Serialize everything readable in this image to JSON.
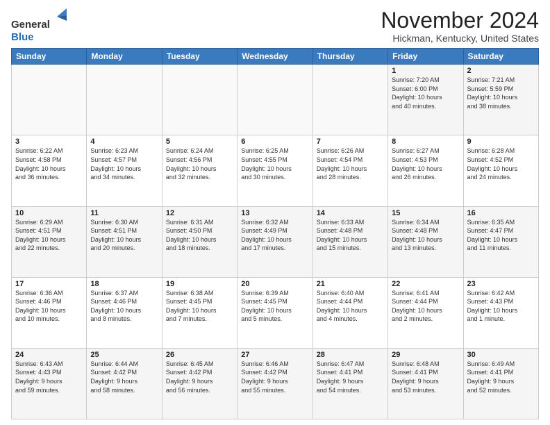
{
  "header": {
    "logo": {
      "line1": "General",
      "line2": "Blue"
    },
    "title": "November 2024",
    "location": "Hickman, Kentucky, United States"
  },
  "weekdays": [
    "Sunday",
    "Monday",
    "Tuesday",
    "Wednesday",
    "Thursday",
    "Friday",
    "Saturday"
  ],
  "weeks": [
    [
      {
        "day": "",
        "info": ""
      },
      {
        "day": "",
        "info": ""
      },
      {
        "day": "",
        "info": ""
      },
      {
        "day": "",
        "info": ""
      },
      {
        "day": "",
        "info": ""
      },
      {
        "day": "1",
        "info": "Sunrise: 7:20 AM\nSunset: 6:00 PM\nDaylight: 10 hours\nand 40 minutes."
      },
      {
        "day": "2",
        "info": "Sunrise: 7:21 AM\nSunset: 5:59 PM\nDaylight: 10 hours\nand 38 minutes."
      }
    ],
    [
      {
        "day": "3",
        "info": "Sunrise: 6:22 AM\nSunset: 4:58 PM\nDaylight: 10 hours\nand 36 minutes."
      },
      {
        "day": "4",
        "info": "Sunrise: 6:23 AM\nSunset: 4:57 PM\nDaylight: 10 hours\nand 34 minutes."
      },
      {
        "day": "5",
        "info": "Sunrise: 6:24 AM\nSunset: 4:56 PM\nDaylight: 10 hours\nand 32 minutes."
      },
      {
        "day": "6",
        "info": "Sunrise: 6:25 AM\nSunset: 4:55 PM\nDaylight: 10 hours\nand 30 minutes."
      },
      {
        "day": "7",
        "info": "Sunrise: 6:26 AM\nSunset: 4:54 PM\nDaylight: 10 hours\nand 28 minutes."
      },
      {
        "day": "8",
        "info": "Sunrise: 6:27 AM\nSunset: 4:53 PM\nDaylight: 10 hours\nand 26 minutes."
      },
      {
        "day": "9",
        "info": "Sunrise: 6:28 AM\nSunset: 4:52 PM\nDaylight: 10 hours\nand 24 minutes."
      }
    ],
    [
      {
        "day": "10",
        "info": "Sunrise: 6:29 AM\nSunset: 4:51 PM\nDaylight: 10 hours\nand 22 minutes."
      },
      {
        "day": "11",
        "info": "Sunrise: 6:30 AM\nSunset: 4:51 PM\nDaylight: 10 hours\nand 20 minutes."
      },
      {
        "day": "12",
        "info": "Sunrise: 6:31 AM\nSunset: 4:50 PM\nDaylight: 10 hours\nand 18 minutes."
      },
      {
        "day": "13",
        "info": "Sunrise: 6:32 AM\nSunset: 4:49 PM\nDaylight: 10 hours\nand 17 minutes."
      },
      {
        "day": "14",
        "info": "Sunrise: 6:33 AM\nSunset: 4:48 PM\nDaylight: 10 hours\nand 15 minutes."
      },
      {
        "day": "15",
        "info": "Sunrise: 6:34 AM\nSunset: 4:48 PM\nDaylight: 10 hours\nand 13 minutes."
      },
      {
        "day": "16",
        "info": "Sunrise: 6:35 AM\nSunset: 4:47 PM\nDaylight: 10 hours\nand 11 minutes."
      }
    ],
    [
      {
        "day": "17",
        "info": "Sunrise: 6:36 AM\nSunset: 4:46 PM\nDaylight: 10 hours\nand 10 minutes."
      },
      {
        "day": "18",
        "info": "Sunrise: 6:37 AM\nSunset: 4:46 PM\nDaylight: 10 hours\nand 8 minutes."
      },
      {
        "day": "19",
        "info": "Sunrise: 6:38 AM\nSunset: 4:45 PM\nDaylight: 10 hours\nand 7 minutes."
      },
      {
        "day": "20",
        "info": "Sunrise: 6:39 AM\nSunset: 4:45 PM\nDaylight: 10 hours\nand 5 minutes."
      },
      {
        "day": "21",
        "info": "Sunrise: 6:40 AM\nSunset: 4:44 PM\nDaylight: 10 hours\nand 4 minutes."
      },
      {
        "day": "22",
        "info": "Sunrise: 6:41 AM\nSunset: 4:44 PM\nDaylight: 10 hours\nand 2 minutes."
      },
      {
        "day": "23",
        "info": "Sunrise: 6:42 AM\nSunset: 4:43 PM\nDaylight: 10 hours\nand 1 minute."
      }
    ],
    [
      {
        "day": "24",
        "info": "Sunrise: 6:43 AM\nSunset: 4:43 PM\nDaylight: 9 hours\nand 59 minutes."
      },
      {
        "day": "25",
        "info": "Sunrise: 6:44 AM\nSunset: 4:42 PM\nDaylight: 9 hours\nand 58 minutes."
      },
      {
        "day": "26",
        "info": "Sunrise: 6:45 AM\nSunset: 4:42 PM\nDaylight: 9 hours\nand 56 minutes."
      },
      {
        "day": "27",
        "info": "Sunrise: 6:46 AM\nSunset: 4:42 PM\nDaylight: 9 hours\nand 55 minutes."
      },
      {
        "day": "28",
        "info": "Sunrise: 6:47 AM\nSunset: 4:41 PM\nDaylight: 9 hours\nand 54 minutes."
      },
      {
        "day": "29",
        "info": "Sunrise: 6:48 AM\nSunset: 4:41 PM\nDaylight: 9 hours\nand 53 minutes."
      },
      {
        "day": "30",
        "info": "Sunrise: 6:49 AM\nSunset: 4:41 PM\nDaylight: 9 hours\nand 52 minutes."
      }
    ]
  ]
}
